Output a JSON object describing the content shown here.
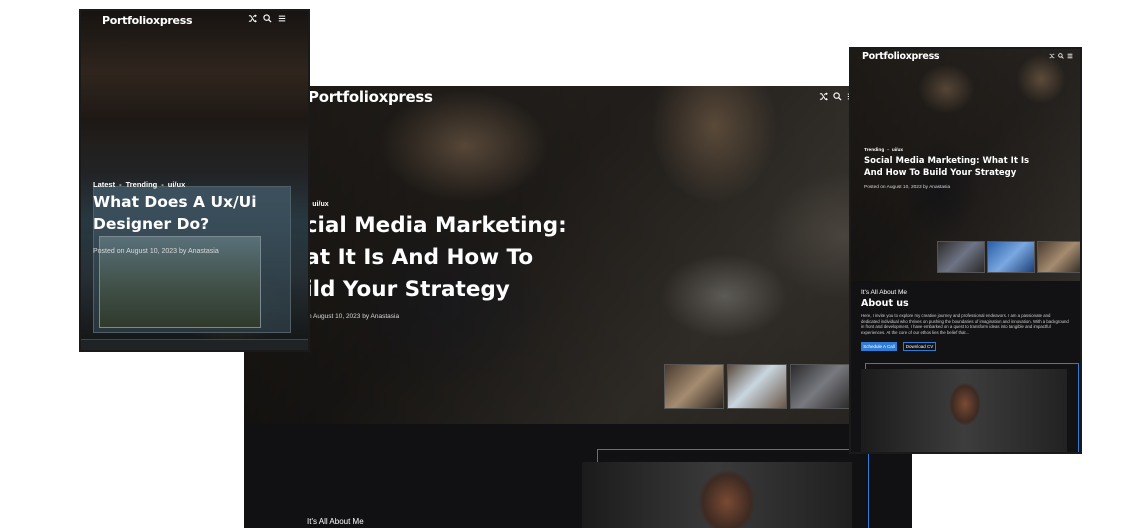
{
  "brand": "Portfolioxpress",
  "icons": [
    "shuffle-icon",
    "search-icon",
    "menu-icon"
  ],
  "accent_color": "#2f7cd6",
  "left_card": {
    "crumbs": [
      "Latest",
      "-",
      "Trending",
      "-",
      "ui/ux"
    ],
    "title": "What Does A Ux/Ui Designer Do?",
    "meta": "Posted on August 10, 2023 by Anastasia"
  },
  "main_card": {
    "crumb_partial": "- ui/ux",
    "title_lines": [
      "ocial Media Marketing:",
      "hat It Is And How To",
      "uild Your Strategy"
    ],
    "meta": "n August 10, 2023 by Anastasia",
    "about_eyebrow": "It's All About Me"
  },
  "right_card": {
    "crumbs": [
      "Trending",
      "-",
      "ui/ux"
    ],
    "title": "Social Media Marketing: What It Is And How To Build Your Strategy",
    "meta": "Posted on August 10, 2023 by Anastasia",
    "about_eyebrow": "It's All About Me",
    "about_title": "About us",
    "about_text": "Here, I invite you to explore my creative journey and professional endeavors. I am a passionate and dedicated individual who thrives on pushing the boundaries of imagination and innovation. With a background in front and development, I have embarked on a quest to transform ideas into tangible and impactful experiences. At the core of our ethos lies the belief that...",
    "btn_primary": "Schedule A Call",
    "btn_secondary": "Download CV"
  }
}
